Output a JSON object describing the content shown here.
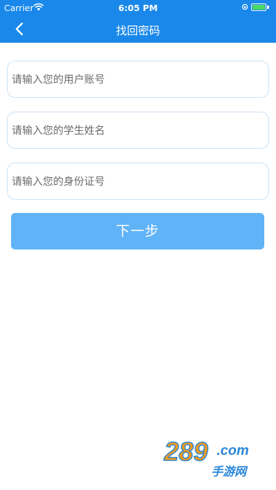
{
  "status_bar": {
    "carrier": "Carrier",
    "time": "6:05 PM",
    "battery_color": "#4cd964"
  },
  "navbar": {
    "title": "找回密码",
    "back_icon": "chevron-left-icon",
    "background_color": "#1a88ea"
  },
  "form": {
    "account_placeholder": "请输入您的用户账号",
    "name_placeholder": "请输入您的学生姓名",
    "id_placeholder": "请输入您的身份证号",
    "next_label": "下一步",
    "button_color": "#61b3f7"
  },
  "watermark": {
    "brand": "289",
    "suffix": ".com",
    "subtitle": "手游网"
  }
}
